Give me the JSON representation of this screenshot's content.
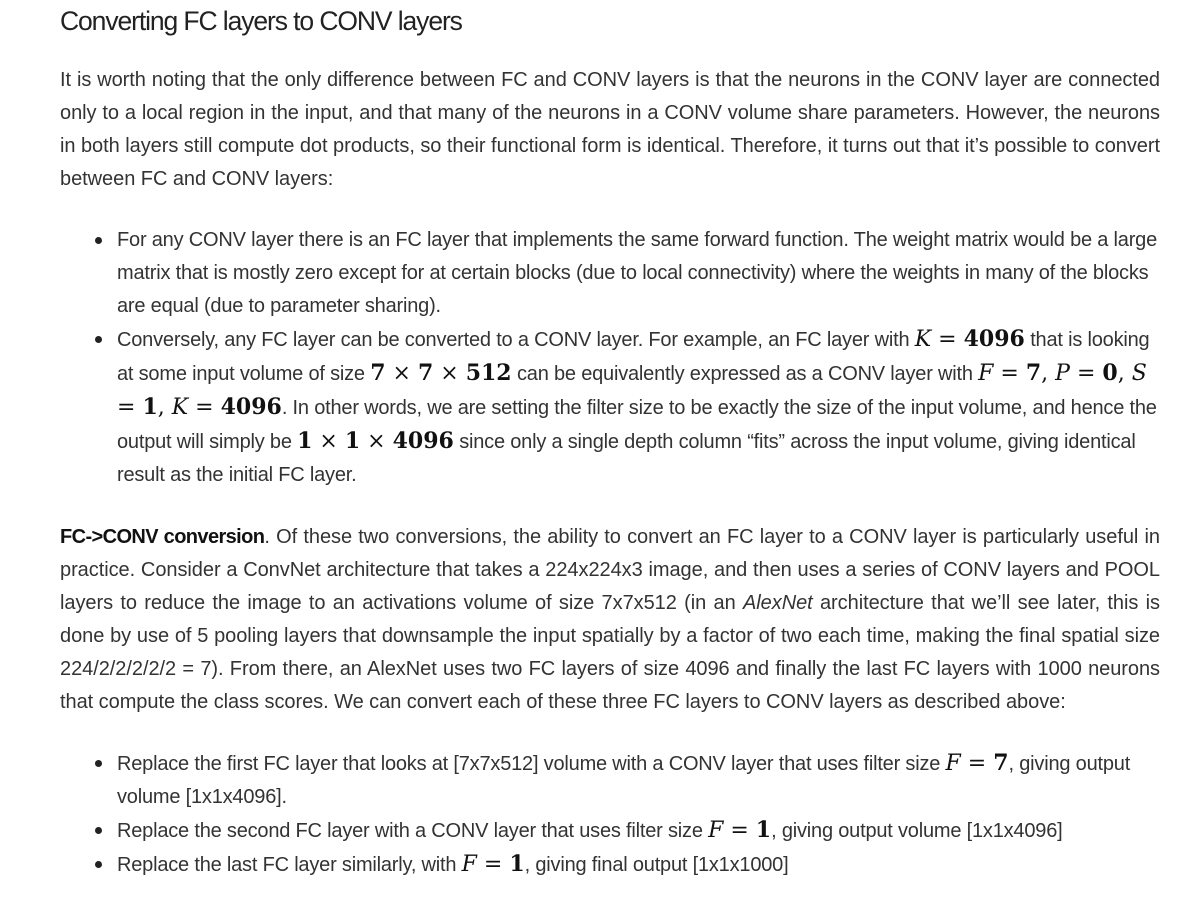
{
  "title": "Converting FC layers to CONV layers",
  "intro": "It is worth noting that the only difference between FC and CONV layers is that the neurons in the CONV layer are connected only to a local region in the input, and that many of the neurons in a CONV volume share parameters. However, the neurons in both layers still compute dot products, so their functional form is identical. Therefore, it turns out that it’s possible to convert between FC and CONV layers:",
  "bullets_a": {
    "b1": "For any CONV layer there is an FC layer that implements the same forward function. The weight matrix would be a large matrix that is mostly zero except for at certain blocks (due to local connectivity) where the weights in many of the blocks are equal (due to parameter sharing).",
    "b2_t1": "Conversely, any FC layer can be converted to a CONV layer. For example, an FC layer with",
    "b2_m1": "K = 4096",
    "b2_t2": "that is looking at some input volume of size",
    "b2_m2": "7 × 7 × 512",
    "b2_t3": "can be equivalently expressed as a CONV layer with",
    "b2_m3": "F = 7, P = 0, S = 1, K = 4096",
    "b2_t4": ". In other words, we are setting the filter size to be exactly the size of the input volume, and hence the output will simply be",
    "b2_m4": "1 × 1 × 4096",
    "b2_t5": "since only a single depth column “fits” across the input volume, giving identical result as the initial FC layer."
  },
  "fcconv": {
    "lead": "FC->CONV conversion",
    "t1": ". Of these two conversions, the ability to convert an FC layer to a CONV layer is particularly useful in practice. Consider a ConvNet architecture that takes a 224x224x3 image, and then uses a series of CONV layers and POOL layers to reduce the image to an activations volume of size 7x7x512 (in an",
    "em": "AlexNet",
    "t2": "architecture that we’ll see later, this is done by use of 5 pooling layers that downsample the input spatially by a factor of two each time, making the final spatial size 224/2/2/2/2/2 = 7). From there, an AlexNet uses two FC layers of size 4096 and finally the last FC layers with 1000 neurons that compute the class scores. We can convert each of these three FC layers to CONV layers as described above:"
  },
  "bullets_b": {
    "c1_t1": "Replace the first FC layer that looks at [7x7x512] volume with a CONV layer that uses filter size",
    "c1_m": "F = 7",
    "c1_t2": ", giving output volume [1x1x4096].",
    "c2_t1": "Replace the second FC layer with a CONV layer that uses filter size",
    "c2_m": "F = 1",
    "c2_t2": ", giving output volume [1x1x4096]",
    "c3_t1": "Replace the last FC layer similarly, with",
    "c3_m": "F = 1",
    "c3_t2": ", giving final output [1x1x1000]"
  }
}
